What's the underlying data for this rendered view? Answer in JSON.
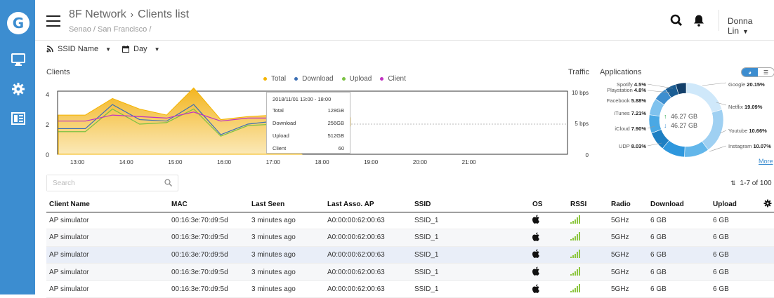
{
  "header": {
    "network": "8F Network",
    "page": "Clients list",
    "breadcrumb": "Senao / San Francisco /",
    "user": "Donna Lin"
  },
  "filters": {
    "ssid": "SSID Name",
    "period": "Day"
  },
  "clients_chart": {
    "title": "Clients",
    "legend": [
      "Total",
      "Download",
      "Upload",
      "Client"
    ],
    "legend_colors": [
      "#f4b400",
      "#3c6fb4",
      "#7ac143",
      "#c132c1"
    ],
    "y_ticks": [
      "4",
      "2",
      "0"
    ],
    "x_ticks": [
      "13:00",
      "14:00",
      "15:00",
      "16:00",
      "17:00",
      "18:00",
      "19:00",
      "20:00",
      "21:00"
    ]
  },
  "chart_data": {
    "type": "area",
    "title": "Clients",
    "x": [
      "12:30",
      "13:00",
      "13:30",
      "14:00",
      "14:30",
      "15:00",
      "15:30",
      "16:00",
      "16:30",
      "17:00"
    ],
    "series": [
      {
        "name": "Total",
        "values": [
          2.6,
          2.6,
          3.7,
          3.0,
          2.6,
          4.4,
          2.3,
          2.5,
          2.6,
          2.6
        ]
      },
      {
        "name": "Download",
        "values": [
          1.7,
          1.7,
          3.3,
          2.3,
          2.2,
          3.3,
          1.3,
          2.0,
          2.2,
          2.2
        ]
      },
      {
        "name": "Upload",
        "values": [
          1.5,
          1.5,
          3.0,
          2.0,
          2.1,
          3.0,
          1.2,
          1.9,
          2.0,
          2.0
        ]
      },
      {
        "name": "Client",
        "values": [
          2.2,
          2.2,
          2.6,
          2.5,
          2.4,
          2.8,
          2.2,
          2.4,
          2.4,
          2.5
        ]
      }
    ],
    "ylim": [
      0,
      4
    ],
    "traffic_ticks": [
      "10 bps",
      "5 bps",
      "0"
    ]
  },
  "tooltip": {
    "title": "2018/11/01 13:00 - 18:00",
    "rows": [
      [
        "Total",
        "128GB"
      ],
      [
        "Download",
        "256GB"
      ],
      [
        "Upload",
        "512GB"
      ],
      [
        "Client",
        "60"
      ]
    ]
  },
  "traffic": {
    "title": "Traffic"
  },
  "applications": {
    "title": "Applications",
    "up": "46.27 GB",
    "down": "46.27 GB",
    "left": [
      [
        "Spotify",
        "4.5%"
      ],
      [
        "Playstation",
        "4.8%"
      ],
      [
        "Facebook",
        "5.88%"
      ],
      [
        "iTunes",
        "7.21%"
      ],
      [
        "iCloud",
        "7.90%"
      ],
      [
        "UDP",
        "8.03%"
      ]
    ],
    "right": [
      [
        "Google",
        "20.15%"
      ],
      [
        "Netflix",
        "19.09%"
      ],
      [
        "Youtube",
        "10.66%"
      ],
      [
        "Instagram",
        "10.07%"
      ]
    ],
    "more": "More",
    "slices": [
      20.15,
      19.09,
      10.66,
      10.07,
      8.03,
      7.9,
      7.21,
      5.88,
      4.8,
      4.5
    ]
  },
  "search": {
    "placeholder": "Search"
  },
  "paging": {
    "range": "1-7 of 100"
  },
  "table": {
    "headers": [
      "Client Name",
      "MAC",
      "Last Seen",
      "Last Asso. AP",
      "SSID",
      "OS",
      "RSSI",
      "Radio",
      "Download",
      "Upload"
    ],
    "rows": [
      [
        "AP simulator",
        "00:16:3e:70:d9:5d",
        "3 minutes ago",
        "A0:00:00:62:00:63",
        "SSID_1",
        "5GHz",
        "6 GB",
        "6 GB"
      ],
      [
        "AP simulator",
        "00:16:3e:70:d9:5d",
        "3 minutes ago",
        "A0:00:00:62:00:63",
        "SSID_1",
        "5GHz",
        "6 GB",
        "6 GB"
      ],
      [
        "AP simulator",
        "00:16:3e:70:d9:5d",
        "3 minutes ago",
        "A0:00:00:62:00:63",
        "SSID_1",
        "5GHz",
        "6 GB",
        "6 GB"
      ],
      [
        "AP simulator",
        "00:16:3e:70:d9:5d",
        "3 minutes ago",
        "A0:00:00:62:00:63",
        "SSID_1",
        "5GHz",
        "6 GB",
        "6 GB"
      ],
      [
        "AP simulator",
        "00:16:3e:70:d9:5d",
        "3 minutes ago",
        "A0:00:00:62:00:63",
        "SSID_1",
        "5GHz",
        "6 GB",
        "6 GB"
      ]
    ]
  }
}
